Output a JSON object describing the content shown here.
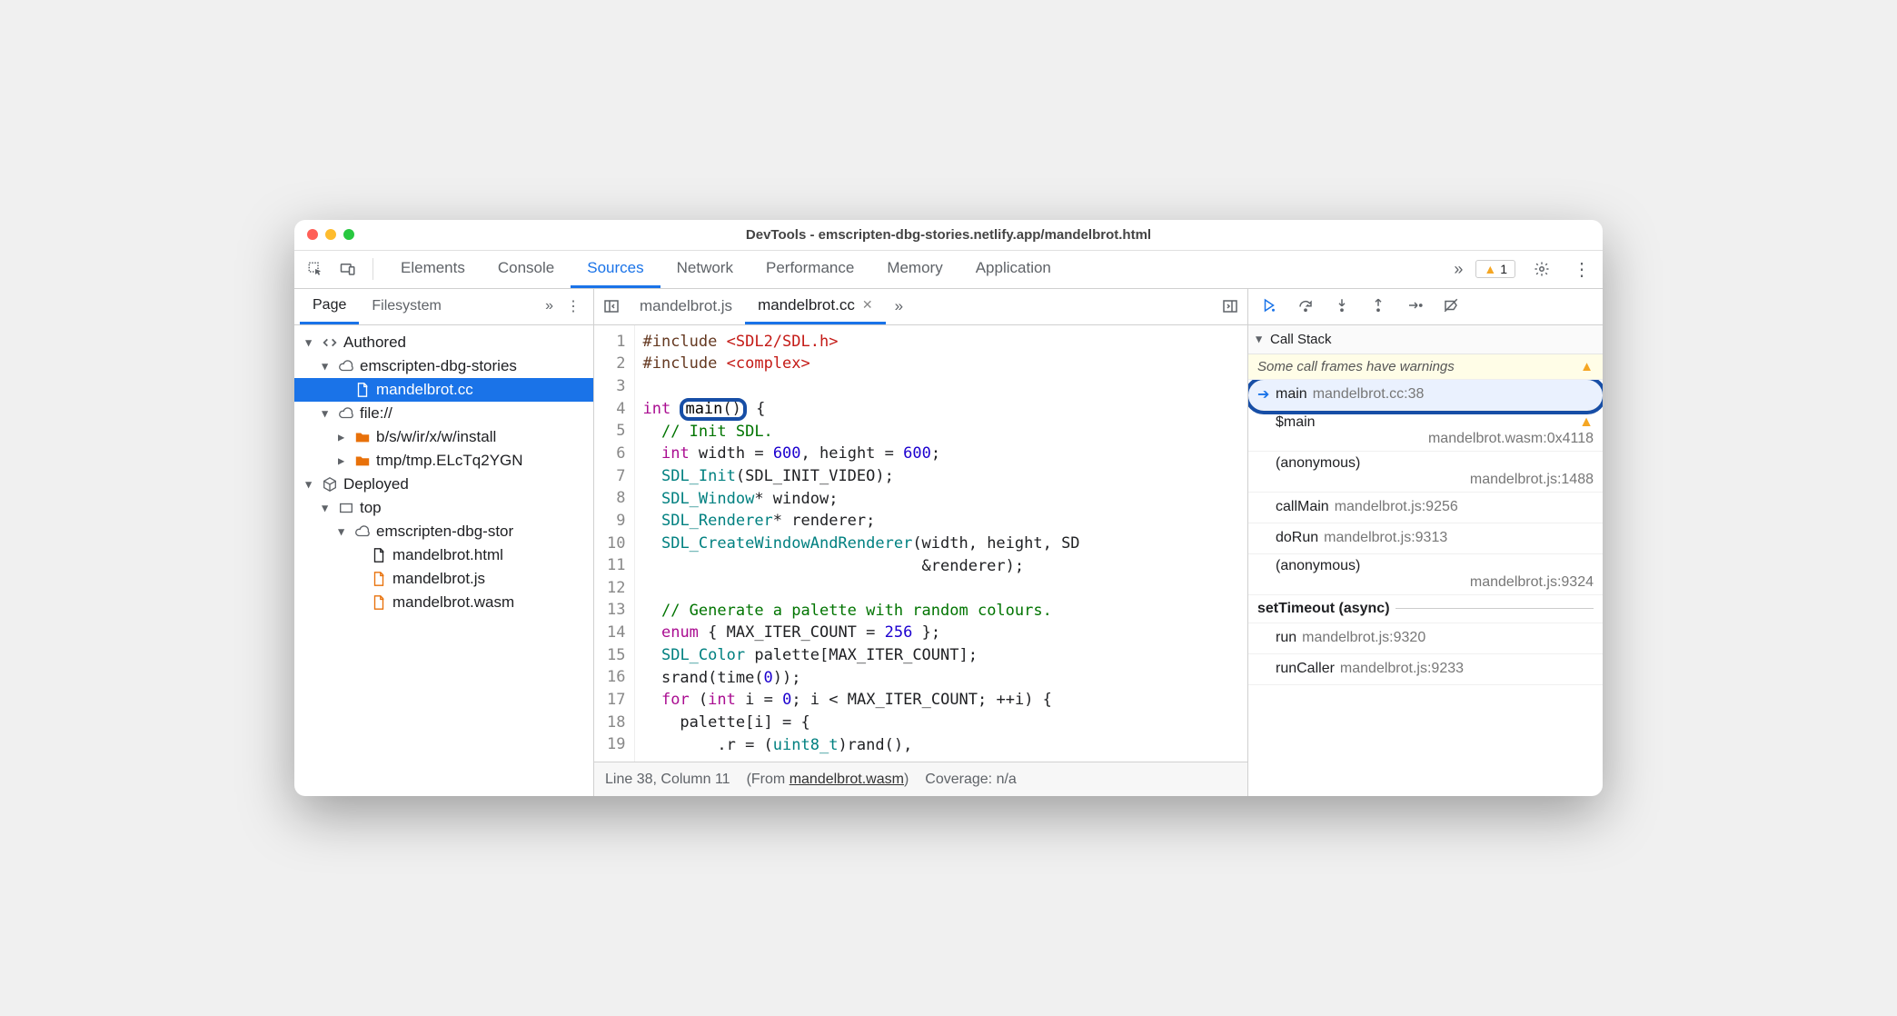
{
  "window": {
    "title": "DevTools - emscripten-dbg-stories.netlify.app/mandelbrot.html"
  },
  "toolbar": {
    "tabs": [
      "Elements",
      "Console",
      "Sources",
      "Network",
      "Performance",
      "Memory",
      "Application"
    ],
    "active": "Sources",
    "more": "»",
    "warnings": "1"
  },
  "navigator": {
    "tabs": [
      "Page",
      "Filesystem"
    ],
    "active": "Page",
    "more": "»",
    "tree": [
      {
        "depth": 0,
        "expanded": true,
        "icon": "code",
        "label": "Authored"
      },
      {
        "depth": 1,
        "expanded": true,
        "icon": "cloud",
        "label": "emscripten-dbg-stories"
      },
      {
        "depth": 2,
        "expanded": null,
        "icon": "file",
        "label": "mandelbrot.cc",
        "selected": true
      },
      {
        "depth": 1,
        "expanded": true,
        "icon": "cloud",
        "label": "file://"
      },
      {
        "depth": 2,
        "expanded": false,
        "icon": "folder",
        "label": "b/s/w/ir/x/w/install"
      },
      {
        "depth": 2,
        "expanded": false,
        "icon": "folder",
        "label": "tmp/tmp.ELcTq2YGN"
      },
      {
        "depth": 0,
        "expanded": true,
        "icon": "cube",
        "label": "Deployed"
      },
      {
        "depth": 1,
        "expanded": true,
        "icon": "frame",
        "label": "top"
      },
      {
        "depth": 2,
        "expanded": true,
        "icon": "cloud",
        "label": "emscripten-dbg-stor"
      },
      {
        "depth": 3,
        "expanded": null,
        "icon": "file",
        "label": "mandelbrot.html"
      },
      {
        "depth": 3,
        "expanded": null,
        "icon": "file-o",
        "label": "mandelbrot.js"
      },
      {
        "depth": 3,
        "expanded": null,
        "icon": "file-o",
        "label": "mandelbrot.wasm"
      }
    ]
  },
  "editor": {
    "tabs": [
      {
        "label": "mandelbrot.js",
        "active": false,
        "closable": false
      },
      {
        "label": "mandelbrot.cc",
        "active": true,
        "closable": true
      }
    ],
    "more": "»",
    "lines": [
      {
        "n": 1,
        "html": "<span class='pp'>#include</span> <span class='hl'>&lt;SDL2/SDL.h&gt;</span>"
      },
      {
        "n": 2,
        "html": "<span class='pp'>#include</span> <span class='hl'>&lt;complex&gt;</span>"
      },
      {
        "n": 3,
        "html": ""
      },
      {
        "n": 4,
        "html": "<span class='kw'>int</span> <span class='ring'><span class='tk'>main</span>()</span> {"
      },
      {
        "n": 5,
        "html": "  <span class='cm'>// Init SDL.</span>"
      },
      {
        "n": 6,
        "html": "  <span class='kw'>int</span> width = <span class='num'>600</span>, height = <span class='num'>600</span>;"
      },
      {
        "n": 7,
        "html": "  <span class='id'>SDL_Init</span>(SDL_INIT_VIDEO);"
      },
      {
        "n": 8,
        "html": "  <span class='id'>SDL_Window</span>* window;"
      },
      {
        "n": 9,
        "html": "  <span class='id'>SDL_Renderer</span>* renderer;"
      },
      {
        "n": 10,
        "html": "  <span class='id'>SDL_CreateWindowAndRenderer</span>(width, height, SD"
      },
      {
        "n": 11,
        "html": "                              &amp;renderer);"
      },
      {
        "n": 12,
        "html": ""
      },
      {
        "n": 13,
        "html": "  <span class='cm'>// Generate a palette with random colours.</span>"
      },
      {
        "n": 14,
        "html": "  <span class='kw'>enum</span> { MAX_ITER_COUNT = <span class='num'>256</span> };"
      },
      {
        "n": 15,
        "html": "  <span class='id'>SDL_Color</span> palette[MAX_ITER_COUNT];"
      },
      {
        "n": 16,
        "html": "  srand(time(<span class='num'>0</span>));"
      },
      {
        "n": 17,
        "html": "  <span class='kw'>for</span> (<span class='kw'>int</span> i = <span class='num'>0</span>; i &lt; MAX_ITER_COUNT; ++i) {"
      },
      {
        "n": 18,
        "html": "    palette[i] = {"
      },
      {
        "n": 19,
        "html": "        .r = (<span class='id'>uint8_t</span>)rand(),"
      }
    ],
    "status": {
      "pos": "Line 38, Column 11",
      "from": "(From ",
      "fromlink": "mandelbrot.wasm",
      "fromend": ")",
      "coverage": "Coverage: n/a"
    }
  },
  "debugger": {
    "section": "Call Stack",
    "warning": "Some call frames have warnings",
    "frames": [
      {
        "name": "main",
        "loc": "mandelbrot.cc:38",
        "current": true,
        "warn": false,
        "sub": ""
      },
      {
        "name": "$main",
        "loc": "",
        "warn": true,
        "sub": "mandelbrot.wasm:0x4118"
      },
      {
        "name": "(anonymous)",
        "loc": "",
        "warn": false,
        "sub": "mandelbrot.js:1488"
      },
      {
        "name": "callMain",
        "loc": "mandelbrot.js:9256",
        "warn": false,
        "sub": ""
      },
      {
        "name": "doRun",
        "loc": "mandelbrot.js:9313",
        "warn": false,
        "sub": ""
      },
      {
        "name": "(anonymous)",
        "loc": "",
        "warn": false,
        "sub": "mandelbrot.js:9324"
      }
    ],
    "async": "setTimeout (async)",
    "frames2": [
      {
        "name": "run",
        "loc": "mandelbrot.js:9320"
      },
      {
        "name": "runCaller",
        "loc": "mandelbrot.js:9233"
      }
    ]
  }
}
